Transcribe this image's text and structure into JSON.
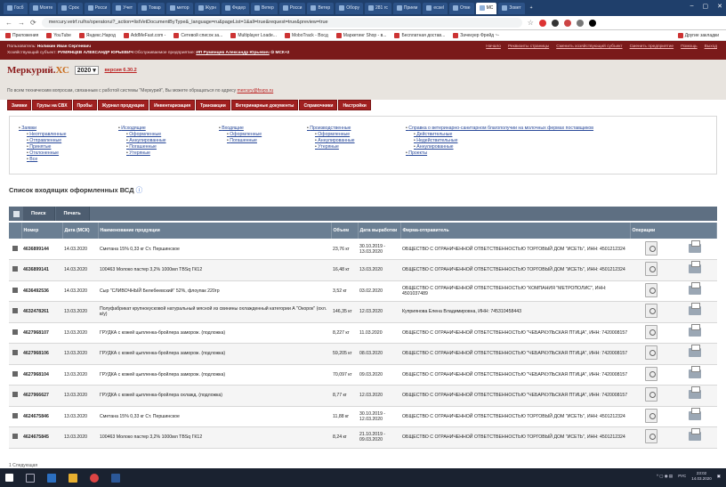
{
  "browser": {
    "tabs": [
      {
        "label": "Госб"
      },
      {
        "label": "Мояте"
      },
      {
        "label": "Срок"
      },
      {
        "label": "Росси"
      },
      {
        "label": "Учет"
      },
      {
        "label": "Товар"
      },
      {
        "label": "метор"
      },
      {
        "label": "Журн"
      },
      {
        "label": "Федер"
      },
      {
        "label": "Ветер"
      },
      {
        "label": "Росси"
      },
      {
        "label": "Ветер"
      },
      {
        "label": "Обору"
      },
      {
        "label": "281 гс"
      },
      {
        "label": "Прием"
      },
      {
        "label": "ecsel"
      },
      {
        "label": "Отве"
      },
      {
        "label": "МС"
      },
      {
        "label": "Зовет"
      }
    ],
    "url": "mercury.vetrf.ru/hs/operatorui?_action=listVetDocumentByType&_language=ru&pageList=1&all=true&request=true&preview=true",
    "bookmarks": [
      "Приложения",
      "YouTube",
      "Яндекс.Народ",
      "AddMeFast.com -",
      "Сетевой список за...",
      "Multiplayer Loade...",
      "MoboTrack - Восд",
      "Маркетинг Shop - в...",
      "Бесплатная достав...",
      "Зачекуер Фрейд ~-",
      "Другие закладки"
    ]
  },
  "userbar": {
    "user_label": "Пользователь:",
    "user_name": "Ноликин Иван Сергеевич",
    "entity_label": "Хозяйствующий субъект:",
    "entity_name": "РУМЯНЦЕВ АЛЕКСАНДР ЮРЬЕВИЧ",
    "enterprise_label": "Обслуживаемое предприятие:",
    "enterprise_name": "ИП Румянцев Александр Юрьевич",
    "enterprise_code": "МСК+2",
    "links": [
      "Начало",
      "Реквизиты страницы",
      "Сменить хозяйствующий субъект",
      "Сменить предприятие",
      "Помощь",
      "Выход"
    ]
  },
  "header": {
    "logo_main": "Меркурий.",
    "logo_suffix": "ХС",
    "year": "2020",
    "version": "версия 6.30.2",
    "support_text": "По всем техническим вопросам, связанным с работой системы \"Меркурий\", Вы можете обращаться по адресу",
    "support_email": "mercury@fsvps.ru"
  },
  "menu": [
    "Заявки",
    "Грузы на СВХ",
    "Пробы",
    "Журнал продукции",
    "Инвентаризация",
    "Транзакции",
    "Ветеринарные документы",
    "Справочники",
    "Настройки"
  ],
  "nav_links": {
    "col1": {
      "title": "Заявки",
      "items": [
        "Неотправленные",
        "Отправленные",
        "Принятые",
        "Отклоненные",
        "Все"
      ]
    },
    "col2": {
      "title": "Исходящие",
      "items": [
        "Оформленные",
        "Аннулированные",
        "Погашенные",
        "Утеряные"
      ]
    },
    "col3": {
      "title": "Входящие",
      "items": [
        "Оформленные",
        "Погашенные"
      ]
    },
    "col4": {
      "title": "Производственные",
      "items": [
        "Оформленные",
        "Аннулированные",
        "Утеряные"
      ]
    },
    "col5": {
      "title": "Справка о ветеринарно-санитарном благополучии на молочных фермах поставщиков",
      "items": [
        "Действительные",
        "Недействительные",
        "Аннулированные"
      ],
      "extra": "Проекты"
    }
  },
  "list_title": "Список входящих оформленных ВСД",
  "toolbar": {
    "search": "Поиск",
    "print": "Печать"
  },
  "table": {
    "headers": [
      "Номер",
      "Дата (МСК)",
      "Наименование продукции",
      "Объем",
      "Дата выработки",
      "Фирма-отправитель",
      "Операции"
    ],
    "rows": [
      {
        "num": "4636899144",
        "date": "14.03.2020",
        "name": "Сметана 15% 0,33 кг Ст. Першинское",
        "vol": "23,76 кг",
        "prod": "30.10.2019 - 13.03.2020",
        "firm": "ОБЩЕСТВО С ОГРАНИЧЕННОЙ ОТВЕТСТВЕННОСТЬЮ ТОРГОВЫЙ ДОМ \"ИСЕТЬ\", ИНН: 4501212324"
      },
      {
        "num": "4636899141",
        "date": "14.03.2020",
        "name": "100463 Молоко пастер 3,2% 1000мл TBSq ГК12",
        "vol": "16,48 кг",
        "prod": "13.03.2020",
        "firm": "ОБЩЕСТВО С ОГРАНИЧЕННОЙ ОТВЕТСТВЕННОСТЬЮ ТОРГОВЫЙ ДОМ \"ИСЕТЬ\", ИНН: 4501212324"
      },
      {
        "num": "4636492536",
        "date": "14.03.2020",
        "name": "Сыр \"СЛИВОЧНЫЙ Белебеевский\" 52%, флоупак 220гр",
        "vol": "3,52 кг",
        "prod": "03.02.2020",
        "firm": "ОБЩЕСТВО С ОГРАНИЧЕННОЙ ОТВЕТСТВЕННОСТЬЮ \"КОМПАНИЯ \"МЕТРОПОЛИС\", ИНН: 4501037489"
      },
      {
        "num": "4632478261",
        "date": "13.03.2020",
        "name": "Полуфабрикат крупнокусковой натуральный мясной из свинины охлажденный категории А \"Окорок\" (охл. в/у)",
        "vol": "146,35 кг",
        "prod": "12.03.2020",
        "firm": "Куприянова Елена Владимировна, ИНН: 745310458443"
      },
      {
        "num": "4627968107",
        "date": "13.03.2020",
        "name": "ГРУДКА с кожей цыпленка-бройлера заморож. (подложка)",
        "vol": "8,227 кг",
        "prod": "11.03.2020",
        "firm": "ОБЩЕСТВО С ОГРАНИЧЕННОЙ ОТВЕТСТВЕННОСТЬЮ \"ЧЕБАРКУЛЬСКАЯ ПТИЦА\", ИНН: 7420008157"
      },
      {
        "num": "4627968106",
        "date": "13.03.2020",
        "name": "ГРУДКА с кожей цыпленка-бройлера заморож. (подложка)",
        "vol": "59,205 кг",
        "prod": "08.03.2020",
        "firm": "ОБЩЕСТВО С ОГРАНИЧЕННОЙ ОТВЕТСТВЕННОСТЬЮ \"ЧЕБАРКУЛЬСКАЯ ПТИЦА\", ИНН: 7420008157"
      },
      {
        "num": "4627968104",
        "date": "13.03.2020",
        "name": "ГРУДКА с кожей цыпленка-бройлера заморож. (подложка)",
        "vol": "70,097 кг",
        "prod": "09.03.2020",
        "firm": "ОБЩЕСТВО С ОГРАНИЧЕННОЙ ОТВЕТСТВЕННОСТЬЮ \"ЧЕБАРКУЛЬСКАЯ ПТИЦА\", ИНН: 7420008157"
      },
      {
        "num": "4627966627",
        "date": "13.03.2020",
        "name": "ГРУДКА с кожей цыпленка-бройлера охлажд. (подложка)",
        "vol": "8,77 кг",
        "prod": "12.03.2020",
        "firm": "ОБЩЕСТВО С ОГРАНИЧЕННОЙ ОТВЕТСТВЕННОСТЬЮ \"ЧЕБАРКУЛЬСКАЯ ПТИЦА\", ИНН: 7420008157"
      },
      {
        "num": "4624675846",
        "date": "13.03.2020",
        "name": "Сметана 15% 0,33 кг Ст. Першинское",
        "vol": "11,88 кг",
        "prod": "30.10.2019 - 12.03.2020",
        "firm": "ОБЩЕСТВО С ОГРАНИЧЕННОЙ ОТВЕТСТВЕННОСТЬЮ ТОРГОВЫЙ ДОМ \"ИСЕТЬ\", ИНН: 4501212324"
      },
      {
        "num": "4624675845",
        "date": "13.03.2020",
        "name": "100463 Молоко пастер 3,2% 1000мл TBSq ГК12",
        "vol": "8,24 кг",
        "prod": "21.10.2019 - 09.03.2020",
        "firm": "ОБЩЕСТВО С ОГРАНИЧЕННОЙ ОТВЕТСТВЕННОСТЬЮ ТОРГОВЫЙ ДОМ \"ИСЕТЬ\", ИНН: 4501212324"
      }
    ]
  },
  "footnote": "1 Следующая",
  "taskbar": {
    "lang": "РУС",
    "time": "23:02",
    "date": "14.03.2020"
  },
  "colors": {
    "brand": "#a02020",
    "header_bg": "#e8e4df",
    "table_head": "#6b7f93"
  }
}
